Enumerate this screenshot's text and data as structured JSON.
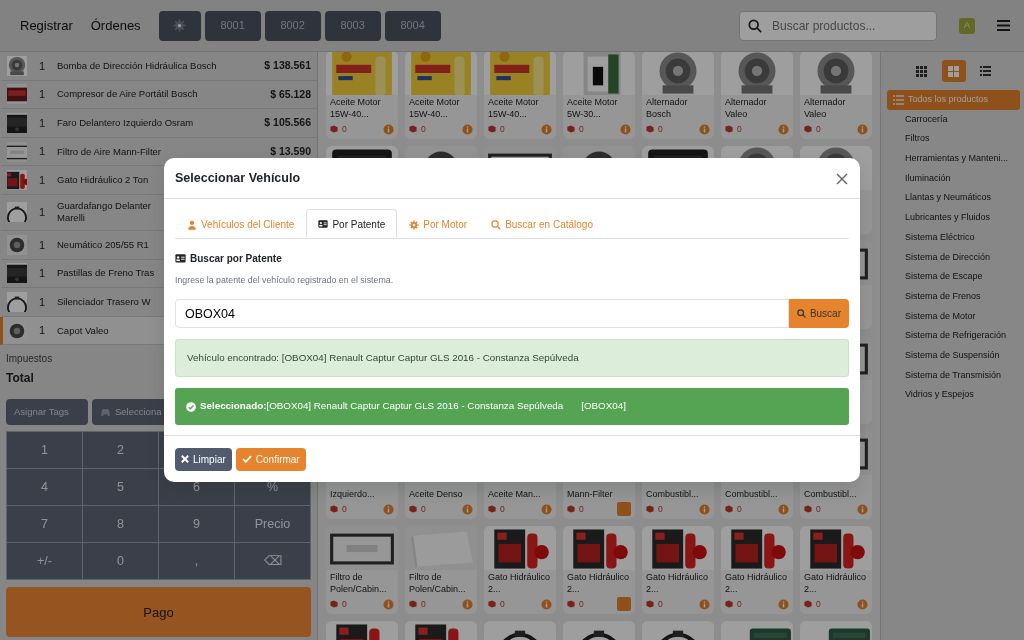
{
  "navbar": {
    "links": [
      {
        "label": "Registrar"
      },
      {
        "label": "Órdenes"
      }
    ],
    "order_tabs": [
      "8001",
      "8002",
      "8003",
      "8004"
    ],
    "search": {
      "placeholder": "Buscar productos..."
    },
    "avatar": "A"
  },
  "cart": {
    "items": [
      {
        "qty": "1",
        "name": "Bomba de Dirección Hidráulica Bosch",
        "price": "$ 138.561",
        "selected": false
      },
      {
        "qty": "1",
        "name": "Compresor de Aire Portátil Bosch",
        "price": "$ 65.128",
        "selected": false
      },
      {
        "qty": "1",
        "name": "Faro Delantero Izquierdo Osram",
        "price": "$ 105.566",
        "selected": false
      },
      {
        "qty": "1",
        "name": "Filtro de Aire Mann-Filter",
        "price": "$ 13.590",
        "selected": false
      },
      {
        "qty": "1",
        "name": "Gato Hidráulico 2 Ton",
        "selected": false
      },
      {
        "qty": "1",
        "name": "Guardafango Delanter\nMarelli",
        "selected": false
      },
      {
        "qty": "1",
        "name": "Neumático 205/55 R1",
        "selected": false
      },
      {
        "qty": "1",
        "name": "Pastillas de Freno Tras",
        "selected": false
      },
      {
        "qty": "1",
        "name": "Silenciador Trasero W",
        "selected": false
      },
      {
        "qty": "1",
        "name": "Capot Valeo",
        "selected": true
      }
    ],
    "tax_label": "Impuestos",
    "total_label": "Total",
    "actions": [
      "Asignar Tags",
      "Selecciona"
    ],
    "keypad": [
      [
        "1",
        "2"
      ],
      [
        "4",
        "5",
        "6",
        "%"
      ],
      [
        "7",
        "8",
        "9",
        "Precio"
      ],
      [
        "+/-",
        "0",
        ",",
        "⌫"
      ]
    ],
    "pay_button": "Pago"
  },
  "products": {
    "rows": [
      {
        "cards": [
          {
            "name": "Aceite Motor 15W-40...",
            "stock": "0",
            "highlighted": false
          },
          {
            "name": "Aceite Motor 15W-40...",
            "stock": "0",
            "highlighted": false
          },
          {
            "name": "Aceite Motor 15W-40...",
            "stock": "0",
            "highlighted": false
          },
          {
            "name": "Aceite Motor 5W-30...",
            "stock": "0",
            "highlighted": false
          },
          {
            "name": "Alternador Bosch",
            "stock": "0",
            "highlighted": false
          },
          {
            "name": "Alternador Valeo",
            "stock": "0",
            "highlighted": false
          },
          {
            "name": "Alternador Valeo",
            "stock": "0",
            "highlighted": false
          }
        ]
      },
      {
        "cards": [
          {
            "name": "Izquierdo...",
            "stock": "0",
            "highlighted": false
          },
          {
            "name": "Aceite Denso",
            "stock": "0",
            "highlighted": false
          },
          {
            "name": "Aceite Man...",
            "stock": "0",
            "highlighted": false
          },
          {
            "name": "Mann-Filter",
            "stock": "0",
            "highlighted": true
          },
          {
            "name": "Combustibl...",
            "stock": "0",
            "highlighted": false
          },
          {
            "name": "Combustibl...",
            "stock": "0",
            "highlighted": false
          },
          {
            "name": "Combustibl...",
            "stock": "0",
            "highlighted": false
          }
        ]
      },
      {
        "cards": [
          {
            "name": "Filtro de Polen/Cabin...",
            "stock": "0",
            "highlighted": false
          },
          {
            "name": "Filtro de Polen/Cabin...",
            "stock": "0",
            "highlighted": false
          },
          {
            "name": "Gato Hidráulico 2...",
            "stock": "0",
            "highlighted": false
          },
          {
            "name": "Gato Hidráulico 2...",
            "stock": "0",
            "highlighted": true
          },
          {
            "name": "Gato Hidráulico 2...",
            "stock": "0",
            "highlighted": false
          },
          {
            "name": "Gato Hidráulico 2...",
            "stock": "0",
            "highlighted": false
          },
          {
            "name": "Gato Hidráulico 2...",
            "stock": "0",
            "highlighted": false
          }
        ]
      },
      {
        "cards": [
          {
            "kind": "picture"
          },
          {
            "kind": "picture"
          },
          {
            "kind": "picture"
          },
          {
            "kind": "picture"
          },
          {
            "kind": "picture"
          },
          {
            "kind": "picture"
          },
          {
            "kind": "picture"
          }
        ]
      }
    ]
  },
  "sidebar": {
    "views": [
      {
        "kind": "small-grid",
        "selected": false
      },
      {
        "kind": "grid",
        "selected": true
      },
      {
        "kind": "list",
        "selected": false
      }
    ],
    "categories": [
      {
        "label": "Todos los productos",
        "selected": true
      },
      {
        "label": "Carrocería",
        "selected": false
      },
      {
        "label": "Filtros",
        "selected": false
      },
      {
        "label": "Herramientas y Manteni...",
        "selected": false
      },
      {
        "label": "Iluminación",
        "selected": false
      },
      {
        "label": "Llantas y Neumáticos",
        "selected": false
      },
      {
        "label": "Lubricantes y Fluidos",
        "selected": false
      },
      {
        "label": "Sistema Eléctrico",
        "selected": false
      },
      {
        "label": "Sistema de Dirección",
        "selected": false
      },
      {
        "label": "Sistema de Escape",
        "selected": false
      },
      {
        "label": "Sistema de Frenos",
        "selected": false
      },
      {
        "label": "Sistema de Motor",
        "selected": false
      },
      {
        "label": "Sistema de Refrigeración",
        "selected": false
      },
      {
        "label": "Sistema de Suspensión",
        "selected": false
      },
      {
        "label": "Sistema de Transmisión",
        "selected": false
      },
      {
        "label": "Vidrios y Espejos",
        "selected": false
      }
    ]
  },
  "modal": {
    "title": "Seleccionar Vehículo",
    "tabs": [
      {
        "label": "Vehículos del Cliente",
        "kind": "user",
        "selected": false
      },
      {
        "label": "Por Patente",
        "kind": "id-card",
        "selected": true
      },
      {
        "label": "Por Motor",
        "kind": "gear",
        "selected": false
      },
      {
        "label": "Buscar en Catálogo",
        "kind": "search",
        "selected": false
      }
    ],
    "heading": "Buscar por Patente",
    "help": "Ingrese la patente del vehículo registrado en el sistema.",
    "plate_input": {
      "value": "OBOX04"
    },
    "search_button": "Buscar",
    "found_message": "Vehículo encontrado: [OBOX04] Renault Captur Captur GLS 2016 - Constanza Sepúlveda",
    "selected_message": "**Seleccionado:**[OBOX04] Renault Captur Captur GLS 2016 - Constanza Sepúlveda",
    "selected_plate": "[OBOX04]",
    "buttons": [
      {
        "label": "Limpiar",
        "kind": "clear"
      },
      {
        "label": "Confirmar",
        "kind": "confirm"
      }
    ]
  }
}
